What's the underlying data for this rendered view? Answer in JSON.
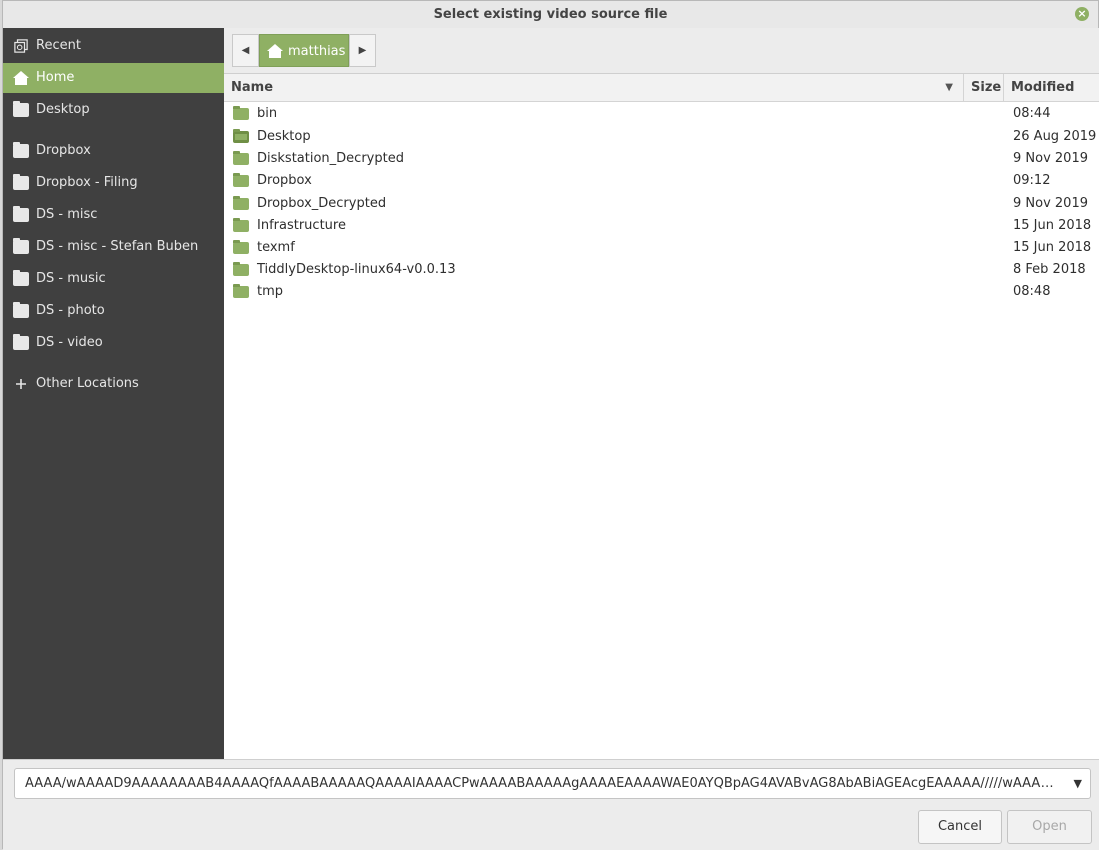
{
  "window": {
    "title": "Select existing video source file"
  },
  "sidebar": {
    "items": [
      {
        "label": "Recent",
        "icon": "recent-icon"
      },
      {
        "label": "Home",
        "icon": "home-icon",
        "active": true
      },
      {
        "label": "Desktop",
        "icon": "desktop-icon"
      },
      {
        "label": "Dropbox",
        "icon": "folder-icon"
      },
      {
        "label": "Dropbox - Filing",
        "icon": "folder-icon"
      },
      {
        "label": "DS - misc",
        "icon": "folder-icon"
      },
      {
        "label": "DS - misc - Stefan Buben",
        "icon": "folder-icon"
      },
      {
        "label": "DS - music",
        "icon": "folder-icon"
      },
      {
        "label": "DS - photo",
        "icon": "folder-icon"
      },
      {
        "label": "DS - video",
        "icon": "folder-icon"
      },
      {
        "label": "Other Locations",
        "icon": "plus-icon"
      }
    ]
  },
  "pathbar": {
    "current": "matthias"
  },
  "filelist": {
    "columns": {
      "name": "Name",
      "size": "Size",
      "modified": "Modified"
    },
    "rows": [
      {
        "name": "bin",
        "size": "",
        "modified": "08:44",
        "icon": "folder-icon"
      },
      {
        "name": "Desktop",
        "size": "",
        "modified": "26 Aug 2019",
        "icon": "desktop-folder-icon"
      },
      {
        "name": "Diskstation_Decrypted",
        "size": "",
        "modified": "9 Nov 2019",
        "icon": "folder-icon"
      },
      {
        "name": "Dropbox",
        "size": "",
        "modified": "09:12",
        "icon": "folder-icon"
      },
      {
        "name": "Dropbox_Decrypted",
        "size": "",
        "modified": "9 Nov 2019",
        "icon": "folder-icon"
      },
      {
        "name": "Infrastructure",
        "size": "",
        "modified": "15 Jun 2018",
        "icon": "folder-icon"
      },
      {
        "name": "texmf",
        "size": "",
        "modified": "15 Jun 2018",
        "icon": "folder-icon"
      },
      {
        "name": "TiddlyDesktop-linux64-v0.0.13",
        "size": "",
        "modified": "8 Feb 2018",
        "icon": "folder-icon"
      },
      {
        "name": "tmp",
        "size": "",
        "modified": "08:48",
        "icon": "folder-icon"
      }
    ]
  },
  "filter": {
    "value": "AAAA/wAAAAD9AAAAAAAAB4AAAAQfAAAABAAAAAQAAAAIAAAACPwAAAABAAAAAgAAAAEAAAAWAE0AYQBpAG4AVABvAG8AbABiAGEAcgEAAAAA/////wAAAAA…"
  },
  "buttons": {
    "cancel": "Cancel",
    "open": "Open"
  },
  "colors": {
    "accent": "#8fb064",
    "sidebar_bg": "#404040"
  }
}
